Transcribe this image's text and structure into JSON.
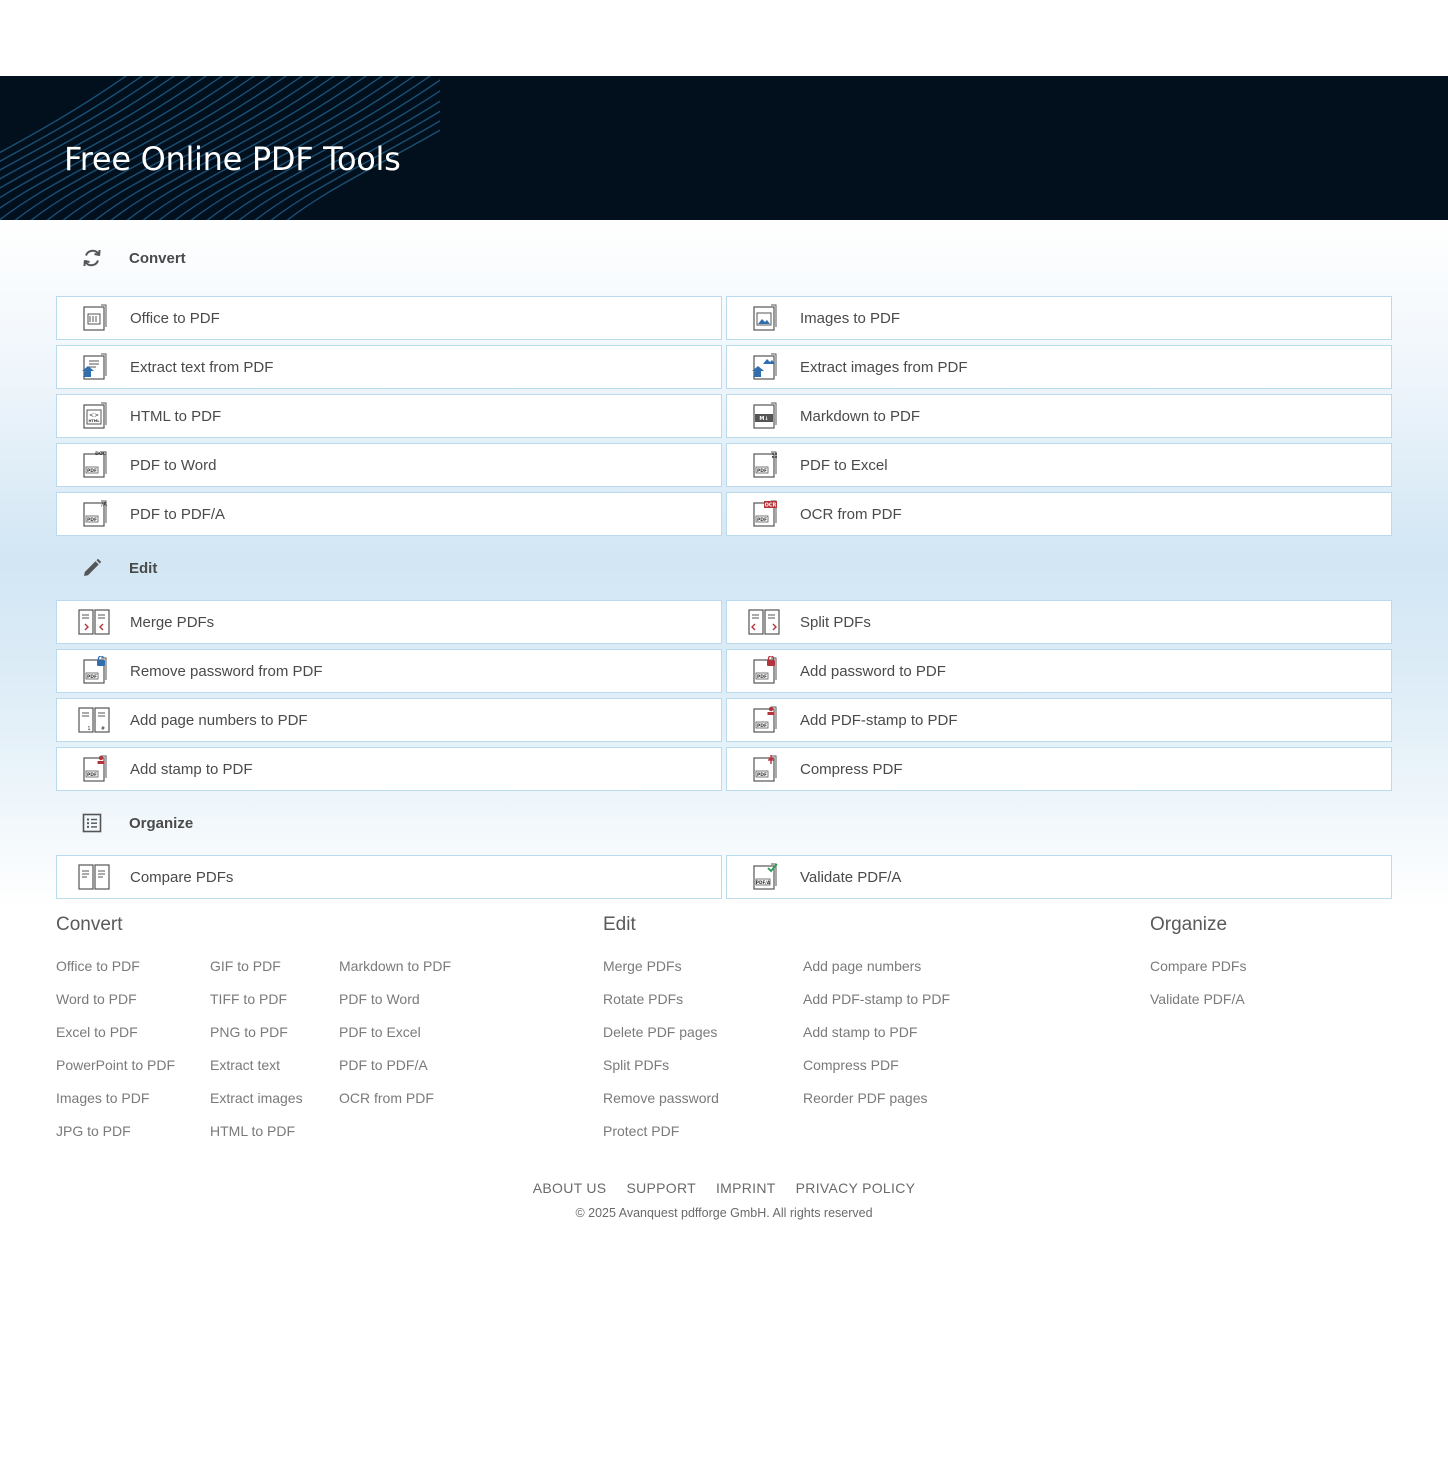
{
  "hero": {
    "title": "Free Online PDF Tools"
  },
  "sections": [
    {
      "label": "Convert",
      "icon": "refresh-icon",
      "tools": [
        {
          "label": "Office to PDF",
          "icon": "office-document-icon"
        },
        {
          "label": "Images to PDF",
          "icon": "image-document-icon"
        },
        {
          "label": "Extract text from PDF",
          "icon": "extract-text-icon"
        },
        {
          "label": "Extract images from PDF",
          "icon": "extract-images-icon"
        },
        {
          "label": "HTML to PDF",
          "icon": "html-document-icon"
        },
        {
          "label": "Markdown to PDF",
          "icon": "markdown-document-icon"
        },
        {
          "label": "PDF to Word",
          "icon": "pdf-to-doc-icon"
        },
        {
          "label": "PDF to Excel",
          "icon": "pdf-to-excel-icon"
        },
        {
          "label": "PDF to PDF/A",
          "icon": "pdf-to-pdfa-icon"
        },
        {
          "label": "OCR from PDF",
          "icon": "ocr-icon"
        }
      ]
    },
    {
      "label": "Edit",
      "icon": "pencil-icon",
      "tools": [
        {
          "label": "Merge PDFs",
          "icon": "merge-icon"
        },
        {
          "label": "Split PDFs",
          "icon": "split-icon"
        },
        {
          "label": "Remove password from PDF",
          "icon": "unlock-icon"
        },
        {
          "label": "Add password to PDF",
          "icon": "lock-icon"
        },
        {
          "label": "Add page numbers to PDF",
          "icon": "page-numbers-icon"
        },
        {
          "label": "Add PDF-stamp to PDF",
          "icon": "pdf-stamp-icon"
        },
        {
          "label": "Add stamp to PDF",
          "icon": "stamp-icon"
        },
        {
          "label": "Compress PDF",
          "icon": "compress-icon"
        }
      ]
    },
    {
      "label": "Organize",
      "icon": "list-icon",
      "tools": [
        {
          "label": "Compare PDFs",
          "icon": "compare-icon"
        },
        {
          "label": "Validate PDF/A",
          "icon": "validate-icon"
        }
      ]
    }
  ],
  "footer": {
    "convert": {
      "heading": "Convert",
      "col1": [
        "Office to PDF",
        "Word to PDF",
        "Excel to PDF",
        "PowerPoint to PDF",
        "Images to PDF",
        "JPG to PDF"
      ],
      "col2": [
        "GIF to PDF",
        "TIFF to PDF",
        "PNG to PDF",
        "Extract text",
        "Extract images",
        "HTML to PDF"
      ],
      "col3": [
        "Markdown to PDF",
        "PDF to Word",
        "PDF to Excel",
        "PDF to PDF/A",
        "OCR from PDF"
      ]
    },
    "edit": {
      "heading": "Edit",
      "col1": [
        "Merge PDFs",
        "Rotate PDFs",
        "Delete PDF pages",
        "Split PDFs",
        "Remove password",
        "Protect PDF"
      ],
      "col2": [
        "Add page numbers",
        "Add PDF-stamp to PDF",
        "Add stamp to PDF",
        "Compress PDF",
        "Reorder PDF pages"
      ]
    },
    "organize": {
      "heading": "Organize",
      "col1": [
        "Compare PDFs",
        "Validate PDF/A"
      ]
    },
    "links": [
      "ABOUT US",
      "SUPPORT",
      "IMPRINT",
      "PRIVACY POLICY"
    ],
    "copyright": "© 2025 Avanquest pdfforge GmbH. All rights reserved"
  },
  "colors": {
    "hero_bg": "#020f1c",
    "tool_border": "#b8dbee",
    "accent_red": "#b5333a",
    "accent_blue": "#2f6fb0",
    "accent_green": "#2e9a5a"
  }
}
